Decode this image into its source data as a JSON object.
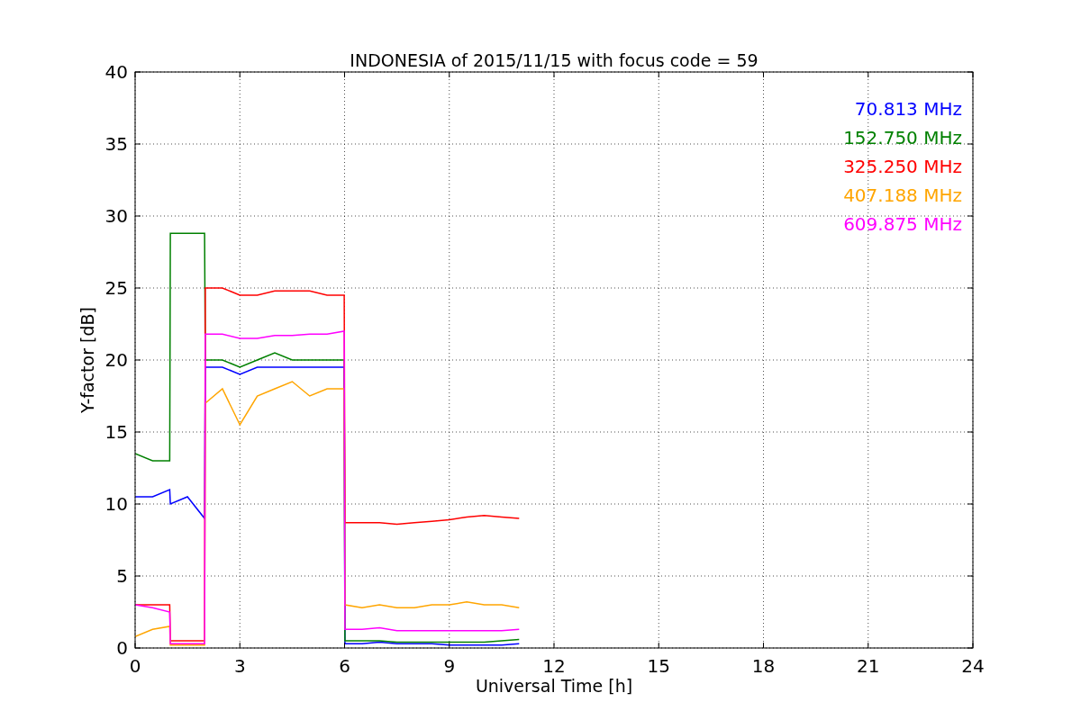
{
  "figure": {
    "chart_data": {
      "type": "line",
      "title": "INDONESIA of 2015/11/15 with focus code = 59",
      "xlabel": "Universal Time [h]",
      "ylabel": "Y-factor [dB]",
      "x": [
        0,
        0.5,
        0.99,
        1.01,
        1.5,
        1.99,
        2.01,
        2.5,
        3,
        3.5,
        4,
        4.5,
        5,
        5.5,
        5.99,
        6.01,
        6.5,
        7,
        7.5,
        8,
        8.5,
        9,
        9.5,
        10,
        10.5,
        11
      ],
      "series": [
        {
          "name": "70.813 MHz",
          "color": "#0000ff",
          "values": [
            10.5,
            10.5,
            11,
            10,
            10.5,
            9,
            19.5,
            19.5,
            19,
            19.5,
            19.5,
            19.5,
            19.5,
            19.5,
            19.5,
            0.3,
            0.3,
            0.4,
            0.3,
            0.3,
            0.3,
            0.2,
            0.2,
            0.2,
            0.2,
            0.3
          ]
        },
        {
          "name": "152.750 MHz",
          "color": "#008000",
          "values": [
            13.5,
            13,
            13,
            28.8,
            28.8,
            28.8,
            20,
            20,
            19.5,
            20,
            20.5,
            20,
            20,
            20,
            20,
            0.5,
            0.5,
            0.5,
            0.4,
            0.4,
            0.4,
            0.4,
            0.4,
            0.4,
            0.5,
            0.6
          ]
        },
        {
          "name": "325.250 MHz",
          "color": "#ff0000",
          "values": [
            3,
            3,
            3,
            0.5,
            0.5,
            0.5,
            25,
            25,
            24.5,
            24.5,
            24.8,
            24.8,
            24.8,
            24.5,
            24.5,
            8.7,
            8.7,
            8.7,
            8.6,
            8.7,
            8.8,
            8.9,
            9.1,
            9.2,
            9.1,
            9
          ]
        },
        {
          "name": "407.188 MHz",
          "color": "#ffa500",
          "values": [
            0.8,
            1.3,
            1.5,
            0.2,
            0.2,
            0.2,
            17,
            18,
            15.5,
            17.5,
            18,
            18.5,
            17.5,
            18,
            18,
            3,
            2.8,
            3,
            2.8,
            2.8,
            3,
            3,
            3.2,
            3,
            3,
            2.8
          ]
        },
        {
          "name": "609.875 MHz",
          "color": "#ff00ff",
          "values": [
            3,
            2.8,
            2.5,
            0.3,
            0.3,
            0.3,
            21.8,
            21.8,
            21.5,
            21.5,
            21.7,
            21.7,
            21.8,
            21.8,
            22,
            1.3,
            1.3,
            1.4,
            1.2,
            1.2,
            1.2,
            1.2,
            1.2,
            1.2,
            1.2,
            1.3
          ]
        }
      ],
      "xlim": [
        0,
        24
      ],
      "ylim": [
        0,
        40
      ],
      "xticks": [
        0,
        3,
        6,
        9,
        12,
        15,
        18,
        21,
        24
      ],
      "yticks": [
        0,
        5,
        10,
        15,
        20,
        25,
        30,
        35,
        40
      ],
      "grid": true
    }
  }
}
